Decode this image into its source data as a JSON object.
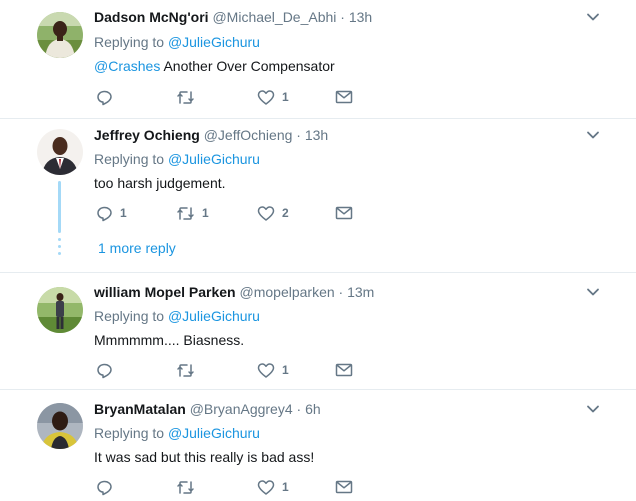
{
  "tweets": [
    {
      "name": "Dadson McNg'ori",
      "handle": "@Michael_De_Abhi",
      "dot": "·",
      "time": "13h",
      "replying_prefix": "Replying to",
      "replying_to": "@JulieGichuru",
      "mention": "@Crashes",
      "text": "Another Over Compensator",
      "reply_count": "",
      "retweet_count": "",
      "like_count": "1"
    },
    {
      "name": "Jeffrey Ochieng",
      "handle": "@JeffOchieng",
      "dot": "·",
      "time": "13h",
      "replying_prefix": "Replying to",
      "replying_to": "@JulieGichuru",
      "text": "too harsh judgement.",
      "reply_count": "1",
      "retweet_count": "1",
      "like_count": "2",
      "more_replies": "1 more reply"
    },
    {
      "name": "william Mopel Parken",
      "handle": "@mopelparken",
      "dot": "·",
      "time": "13m",
      "replying_prefix": "Replying to",
      "replying_to": "@JulieGichuru",
      "text": "Mmmmmm.... Biasness.",
      "reply_count": "",
      "retweet_count": "",
      "like_count": "1"
    },
    {
      "name": "BryanMatalan",
      "handle": "@BryanAggrey4",
      "dot": "·",
      "time": "6h",
      "replying_prefix": "Replying to",
      "replying_to": "@JulieGichuru",
      "text": "It was sad but this really is bad ass!",
      "reply_count": "",
      "retweet_count": "",
      "like_count": "1"
    }
  ],
  "icons": {
    "reply": "reply-icon",
    "retweet": "retweet-icon",
    "like": "heart-icon",
    "dm": "envelope-icon",
    "caret": "chevron-down-icon"
  },
  "colors": {
    "link": "#1b95e0",
    "muted": "#657786",
    "text": "#14171a",
    "thread": "#a4d9f7",
    "divider": "#e6ecf0"
  }
}
